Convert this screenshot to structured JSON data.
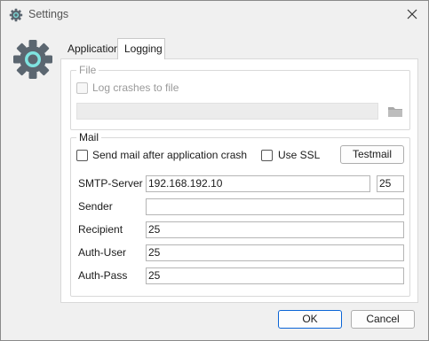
{
  "window": {
    "title": "Settings"
  },
  "tabs": [
    {
      "label": "Application"
    },
    {
      "label": "Logging"
    }
  ],
  "file_group": {
    "title": "File",
    "log_crashes_label": "Log crashes to file",
    "log_crashes_checked": false,
    "path_value": ""
  },
  "mail_group": {
    "title": "Mail",
    "send_mail_label": "Send mail after application crash",
    "send_mail_checked": false,
    "use_ssl_label": "Use SSL",
    "use_ssl_checked": false,
    "testmail_label": "Testmail",
    "fields": {
      "smtp_label": "SMTP-Server",
      "smtp_value": "192.168.192.10",
      "port_value": "25",
      "sender_label": "Sender",
      "sender_value": "",
      "recipient_label": "Recipient",
      "recipient_value": "25",
      "auth_user_label": "Auth-User",
      "auth_user_value": "25",
      "auth_pass_label": "Auth-Pass",
      "auth_pass_value": "25"
    }
  },
  "buttons": {
    "ok": "OK",
    "cancel": "Cancel"
  },
  "icons": {
    "title": "gear-icon",
    "app": "gear-icon",
    "close": "close-icon",
    "folder": "folder-icon"
  },
  "colors": {
    "accent": "#0a64d6",
    "gear_body": "#5b6670",
    "gear_ring": "#7fe3e0"
  }
}
